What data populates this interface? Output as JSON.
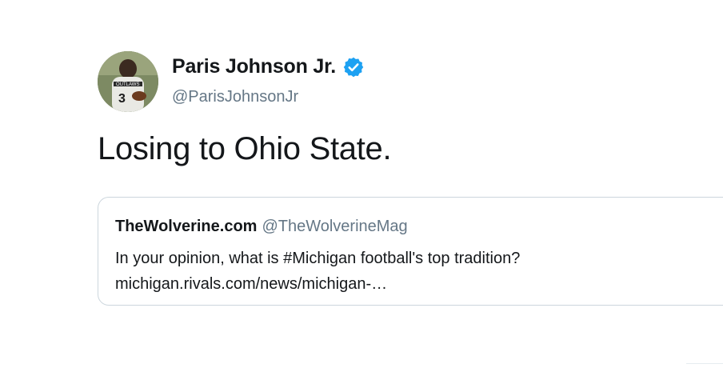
{
  "author": {
    "name": "Paris Johnson Jr.",
    "handle": "@ParisJohnsonJr",
    "verified": true,
    "verified_icon": "verified-badge-icon",
    "avatar_icon": "avatar-photo"
  },
  "tweet": {
    "text": "Losing to Ohio State."
  },
  "quoted_tweet": {
    "name": "TheWolverine.com",
    "handle": "@TheWolverineMag",
    "text_line1": "In your opinion, what is #Michigan football's top tradition?",
    "text_line2": "michigan.rivals.com/news/michigan-…"
  },
  "colors": {
    "primary_text": "#14171a",
    "secondary_text": "#657786",
    "verified_blue": "#1da1f2",
    "border": "#ccd6dd"
  }
}
